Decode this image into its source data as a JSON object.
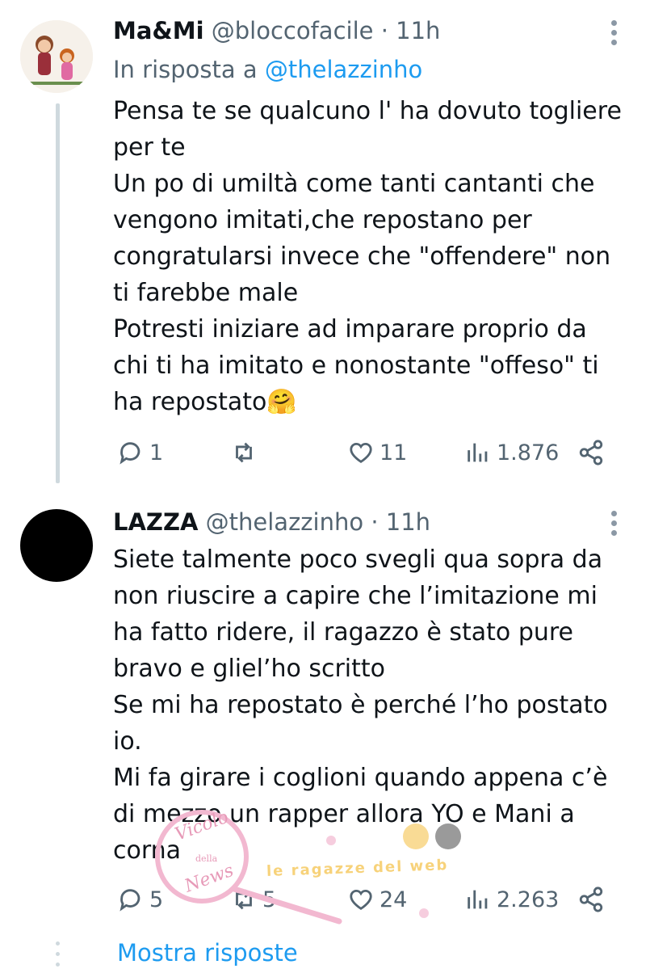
{
  "tweets": [
    {
      "name": "Ma&Mi",
      "handle": "@bloccofacile",
      "separator": "·",
      "time": "11h",
      "reply_prefix": "In risposta a",
      "reply_mention": "@thelazzinho",
      "text": "Pensa te se qualcuno l' ha dovuto togliere\nper te\nUn po di umiltà come tanti cantanti che\nvengono imitati,che repostano per\ncongratularsi invece che \"offendere\" non\nti farebbe male\nPotresti iniziare ad imparare proprio da\nchi ti ha imitato e nonostante \"offeso\" ti\nha repostato🤗",
      "replies": "1",
      "reposts": "",
      "likes": "11",
      "views": "1.876"
    },
    {
      "name": "LAZZA",
      "handle": "@thelazzinho",
      "separator": "·",
      "time": "11h",
      "text": "Siete talmente poco svegli qua sopra da\nnon riuscire a capire che l’imitazione mi\nha fatto ridere, il ragazzo è stato pure\nbravo e gliel’ho scritto\nSe mi ha repostato è perché l’ho postato\nio.\nMi fa girare i coglioni quando appena c’è\ndi mezzo un rapper allora YO e Mani a\ncorna",
      "replies": "5",
      "reposts": "5",
      "likes": "24",
      "views": "2.263"
    }
  ],
  "show_replies": "Mostra risposte",
  "watermark": {
    "text_1": "Vicolo",
    "text_2": "della",
    "text_3": "News",
    "text_4": "le ragazze del web"
  },
  "icons": {
    "reply": "reply-icon",
    "repost": "repost-icon",
    "like": "heart-icon",
    "views": "views-icon",
    "share": "share-icon",
    "more": "more-vertical-icon"
  },
  "colors": {
    "link": "#1d9bf0",
    "secondary_text": "#536471",
    "thread_line": "#cfd9de"
  }
}
